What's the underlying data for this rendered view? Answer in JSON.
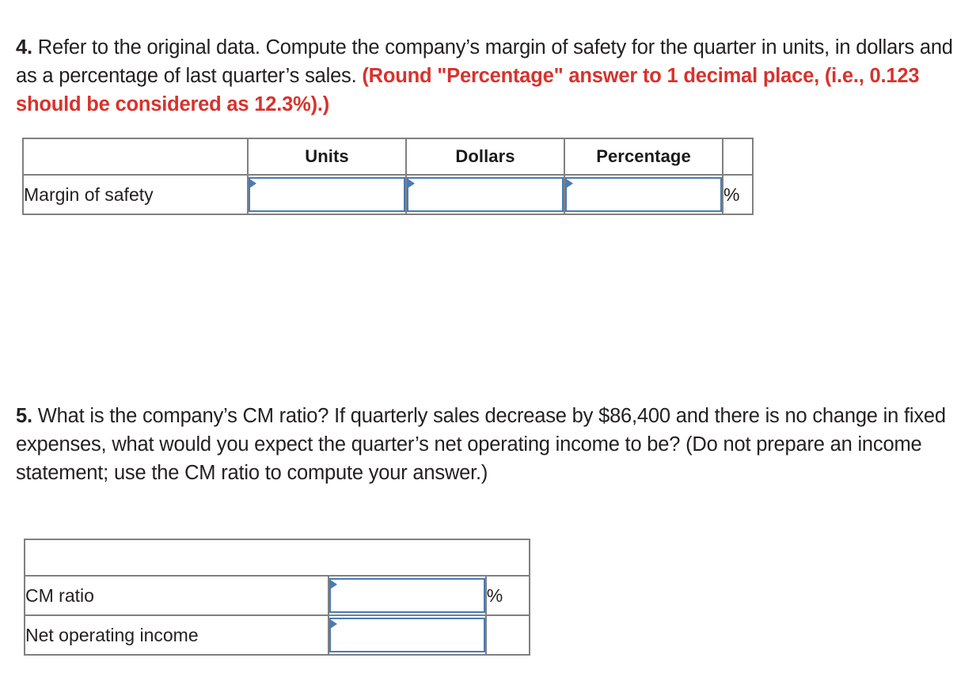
{
  "questions": [
    {
      "number": "4.",
      "body": " Refer to the original data. Compute the company’s margin of safety for the quarter in units, in dollars and as a percentage of last quarter’s sales. ",
      "note": "(Round \"Percentage\" answer to 1 decimal place, (i.e., 0.123 should be considered as 12.3%).)"
    },
    {
      "number": "5.",
      "body": " What is the company’s CM ratio? If quarterly sales decrease by $86,400 and there is no change in fixed expenses, what would you expect the quarter’s net operating income to be? (Do not prepare an income statement; use the CM ratio to compute your answer.)",
      "note": ""
    }
  ],
  "tables": {
    "margin_of_safety": {
      "headers": {
        "blank": "",
        "units": "Units",
        "dollars": "Dollars",
        "percentage": "Percentage",
        "symbol": ""
      },
      "rows": [
        {
          "label": "Margin of safety",
          "units_value": "",
          "units_placeholder": "",
          "dollars_value": "",
          "dollars_placeholder": "",
          "percentage_value": "",
          "percentage_placeholder": "",
          "symbol": "%"
        }
      ]
    },
    "cm_ratio": {
      "headers": {
        "blank": ""
      },
      "rows": [
        {
          "label": "CM ratio",
          "value": "",
          "placeholder": "",
          "symbol": "%"
        },
        {
          "label": "Net operating income",
          "value": "",
          "placeholder": "",
          "symbol": ""
        }
      ]
    }
  },
  "colors": {
    "header_blue": "#81a9dd",
    "input_border_blue": "#4a7ab4",
    "note_red": "#d8322c",
    "table_border_gray": "#808080",
    "text": "#231f20"
  }
}
